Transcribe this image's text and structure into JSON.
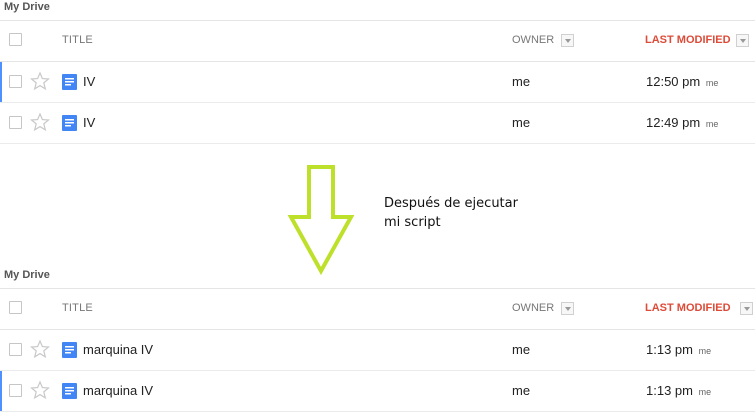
{
  "top": {
    "breadcrumb": "My Drive",
    "columns": {
      "title": "TITLE",
      "owner": "OWNER",
      "modified": "LAST MODIFIED"
    },
    "rows": [
      {
        "title": "IV",
        "owner": "me",
        "modified": "12:50 pm",
        "modified_by": "me",
        "selected": true
      },
      {
        "title": "IV",
        "owner": "me",
        "modified": "12:49 pm",
        "modified_by": "me",
        "selected": false
      }
    ]
  },
  "annotation": {
    "line1": "Después de ejecutar",
    "line2": "mi script",
    "arrow_color": "#bde02a"
  },
  "bottom": {
    "breadcrumb": "My Drive",
    "columns": {
      "title": "TITLE",
      "owner": "OWNER",
      "modified": "LAST MODIFIED"
    },
    "rows": [
      {
        "title": "marquina IV",
        "owner": "me",
        "modified": "1:13 pm",
        "modified_by": "me",
        "selected": false
      },
      {
        "title": "marquina IV",
        "owner": "me",
        "modified": "1:13 pm",
        "modified_by": "me",
        "selected": true
      }
    ]
  },
  "colors": {
    "accent_sort": "#dd4b39",
    "doc_icon": "#4285f4",
    "selection_bar": "#4d90fe"
  }
}
